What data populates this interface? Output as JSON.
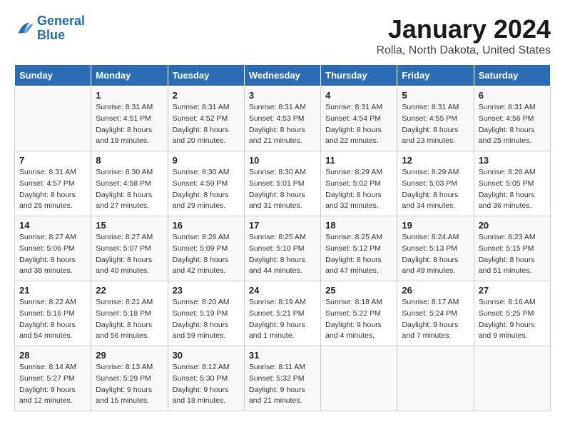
{
  "header": {
    "logo_line1": "General",
    "logo_line2": "Blue",
    "title": "January 2024",
    "subtitle": "Rolla, North Dakota, United States"
  },
  "days_of_week": [
    "Sunday",
    "Monday",
    "Tuesday",
    "Wednesday",
    "Thursday",
    "Friday",
    "Saturday"
  ],
  "weeks": [
    [
      {
        "num": "",
        "sunrise": "",
        "sunset": "",
        "daylight": ""
      },
      {
        "num": "1",
        "sunrise": "Sunrise: 8:31 AM",
        "sunset": "Sunset: 4:51 PM",
        "daylight": "Daylight: 8 hours and 19 minutes."
      },
      {
        "num": "2",
        "sunrise": "Sunrise: 8:31 AM",
        "sunset": "Sunset: 4:52 PM",
        "daylight": "Daylight: 8 hours and 20 minutes."
      },
      {
        "num": "3",
        "sunrise": "Sunrise: 8:31 AM",
        "sunset": "Sunset: 4:53 PM",
        "daylight": "Daylight: 8 hours and 21 minutes."
      },
      {
        "num": "4",
        "sunrise": "Sunrise: 8:31 AM",
        "sunset": "Sunset: 4:54 PM",
        "daylight": "Daylight: 8 hours and 22 minutes."
      },
      {
        "num": "5",
        "sunrise": "Sunrise: 8:31 AM",
        "sunset": "Sunset: 4:55 PM",
        "daylight": "Daylight: 8 hours and 23 minutes."
      },
      {
        "num": "6",
        "sunrise": "Sunrise: 8:31 AM",
        "sunset": "Sunset: 4:56 PM",
        "daylight": "Daylight: 8 hours and 25 minutes."
      }
    ],
    [
      {
        "num": "7",
        "sunrise": "",
        "sunset": "",
        "daylight": ""
      },
      {
        "num": "8",
        "sunrise": "Sunrise: 8:30 AM",
        "sunset": "Sunset: 4:58 PM",
        "daylight": "Daylight: 8 hours and 27 minutes."
      },
      {
        "num": "9",
        "sunrise": "Sunrise: 8:30 AM",
        "sunset": "Sunset: 4:59 PM",
        "daylight": "Daylight: 8 hours and 29 minutes."
      },
      {
        "num": "10",
        "sunrise": "Sunrise: 8:30 AM",
        "sunset": "Sunset: 5:01 PM",
        "daylight": "Daylight: 8 hours and 31 minutes."
      },
      {
        "num": "11",
        "sunrise": "Sunrise: 8:29 AM",
        "sunset": "Sunset: 5:02 PM",
        "daylight": "Daylight: 8 hours and 32 minutes."
      },
      {
        "num": "12",
        "sunrise": "Sunrise: 8:29 AM",
        "sunset": "Sunset: 5:03 PM",
        "daylight": "Daylight: 8 hours and 34 minutes."
      },
      {
        "num": "13",
        "sunrise": "Sunrise: 8:28 AM",
        "sunset": "Sunset: 5:05 PM",
        "daylight": "Daylight: 8 hours and 36 minutes."
      }
    ],
    [
      {
        "num": "14",
        "sunrise": "",
        "sunset": "",
        "daylight": ""
      },
      {
        "num": "15",
        "sunrise": "Sunrise: 8:27 AM",
        "sunset": "Sunset: 5:07 PM",
        "daylight": "Daylight: 8 hours and 40 minutes."
      },
      {
        "num": "16",
        "sunrise": "Sunrise: 8:26 AM",
        "sunset": "Sunset: 5:09 PM",
        "daylight": "Daylight: 8 hours and 42 minutes."
      },
      {
        "num": "17",
        "sunrise": "Sunrise: 8:25 AM",
        "sunset": "Sunset: 5:10 PM",
        "daylight": "Daylight: 8 hours and 44 minutes."
      },
      {
        "num": "18",
        "sunrise": "Sunrise: 8:25 AM",
        "sunset": "Sunset: 5:12 PM",
        "daylight": "Daylight: 8 hours and 47 minutes."
      },
      {
        "num": "19",
        "sunrise": "Sunrise: 8:24 AM",
        "sunset": "Sunset: 5:13 PM",
        "daylight": "Daylight: 8 hours and 49 minutes."
      },
      {
        "num": "20",
        "sunrise": "Sunrise: 8:23 AM",
        "sunset": "Sunset: 5:15 PM",
        "daylight": "Daylight: 8 hours and 51 minutes."
      }
    ],
    [
      {
        "num": "21",
        "sunrise": "",
        "sunset": "",
        "daylight": ""
      },
      {
        "num": "22",
        "sunrise": "Sunrise: 8:21 AM",
        "sunset": "Sunset: 5:18 PM",
        "daylight": "Daylight: 8 hours and 56 minutes."
      },
      {
        "num": "23",
        "sunrise": "Sunrise: 8:20 AM",
        "sunset": "Sunset: 5:19 PM",
        "daylight": "Daylight: 8 hours and 59 minutes."
      },
      {
        "num": "24",
        "sunrise": "Sunrise: 8:19 AM",
        "sunset": "Sunset: 5:21 PM",
        "daylight": "Daylight: 9 hours and 1 minute."
      },
      {
        "num": "25",
        "sunrise": "Sunrise: 8:18 AM",
        "sunset": "Sunset: 5:22 PM",
        "daylight": "Daylight: 9 hours and 4 minutes."
      },
      {
        "num": "26",
        "sunrise": "Sunrise: 8:17 AM",
        "sunset": "Sunset: 5:24 PM",
        "daylight": "Daylight: 9 hours and 7 minutes."
      },
      {
        "num": "27",
        "sunrise": "Sunrise: 8:16 AM",
        "sunset": "Sunset: 5:25 PM",
        "daylight": "Daylight: 9 hours and 9 minutes."
      }
    ],
    [
      {
        "num": "28",
        "sunrise": "Sunrise: 8:14 AM",
        "sunset": "Sunset: 5:27 PM",
        "daylight": "Daylight: 9 hours and 12 minutes."
      },
      {
        "num": "29",
        "sunrise": "Sunrise: 8:13 AM",
        "sunset": "Sunset: 5:29 PM",
        "daylight": "Daylight: 9 hours and 15 minutes."
      },
      {
        "num": "30",
        "sunrise": "Sunrise: 8:12 AM",
        "sunset": "Sunset: 5:30 PM",
        "daylight": "Daylight: 9 hours and 18 minutes."
      },
      {
        "num": "31",
        "sunrise": "Sunrise: 8:11 AM",
        "sunset": "Sunset: 5:32 PM",
        "daylight": "Daylight: 9 hours and 21 minutes."
      },
      {
        "num": "",
        "sunrise": "",
        "sunset": "",
        "daylight": ""
      },
      {
        "num": "",
        "sunrise": "",
        "sunset": "",
        "daylight": ""
      },
      {
        "num": "",
        "sunrise": "",
        "sunset": "",
        "daylight": ""
      }
    ]
  ],
  "week1_day7_data": {
    "sunrise": "Sunrise: 8:31 AM",
    "sunset": "Sunset: 4:57 PM",
    "daylight": "Daylight: 8 hours and 26 minutes."
  },
  "week2_day14_data": {
    "sunrise": "Sunrise: 8:27 AM",
    "sunset": "Sunset: 5:06 PM",
    "daylight": "Daylight: 8 hours and 38 minutes."
  },
  "week3_day21_data": {
    "sunrise": "Sunrise: 8:22 AM",
    "sunset": "Sunset: 5:16 PM",
    "daylight": "Daylight: 8 hours and 54 minutes."
  }
}
